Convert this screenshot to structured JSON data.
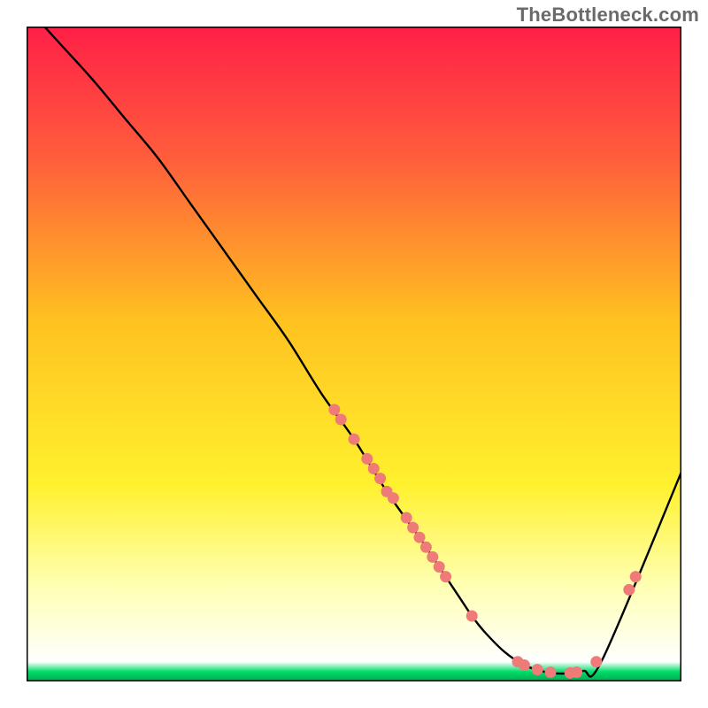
{
  "watermark": "TheBottleneck.com",
  "chart_data": {
    "type": "line",
    "title": "",
    "xlabel": "",
    "ylabel": "",
    "xlim": [
      0,
      100
    ],
    "ylim": [
      0,
      100
    ],
    "curve": {
      "name": "bottleneck-curve",
      "x": [
        0,
        5,
        10,
        15,
        20,
        25,
        30,
        35,
        40,
        45,
        50,
        55,
        60,
        62,
        64,
        66,
        68,
        70,
        73,
        76,
        79,
        82,
        85,
        88,
        100
      ],
      "y": [
        103,
        97.5,
        92,
        86,
        80,
        73,
        66,
        59,
        52,
        44,
        37,
        29,
        22,
        19,
        16,
        13,
        10,
        7.5,
        4.5,
        2.5,
        1.5,
        1.2,
        1.6,
        3.5,
        32
      ]
    },
    "scatter_on_curve": {
      "name": "points",
      "color": "#ee7b78",
      "radius": 6.5,
      "x": [
        47,
        48,
        50,
        52,
        53,
        54,
        55,
        56,
        58,
        59,
        60,
        61,
        62,
        63,
        64,
        68,
        75,
        76,
        78,
        80,
        83,
        84,
        87,
        92,
        93
      ],
      "y": [
        41.5,
        40,
        37,
        34,
        32.5,
        31,
        29,
        28,
        25,
        23.5,
        22,
        20.5,
        19,
        17.5,
        16,
        10,
        3,
        2.5,
        1.8,
        1.4,
        1.3,
        1.4,
        3,
        14,
        16
      ]
    },
    "gradient_stops": [
      {
        "offset": 0.0,
        "color": "#ff1f47"
      },
      {
        "offset": 0.2,
        "color": "#ff5d3c"
      },
      {
        "offset": 0.45,
        "color": "#ffc220"
      },
      {
        "offset": 0.7,
        "color": "#fff12e"
      },
      {
        "offset": 0.85,
        "color": "#ffffb0"
      },
      {
        "offset": 0.97,
        "color": "#ffffff"
      },
      {
        "offset": 0.985,
        "color": "#00de6a"
      },
      {
        "offset": 1.0,
        "color": "#00a850"
      }
    ],
    "axis_color": "#000000",
    "axis_width": 3
  }
}
